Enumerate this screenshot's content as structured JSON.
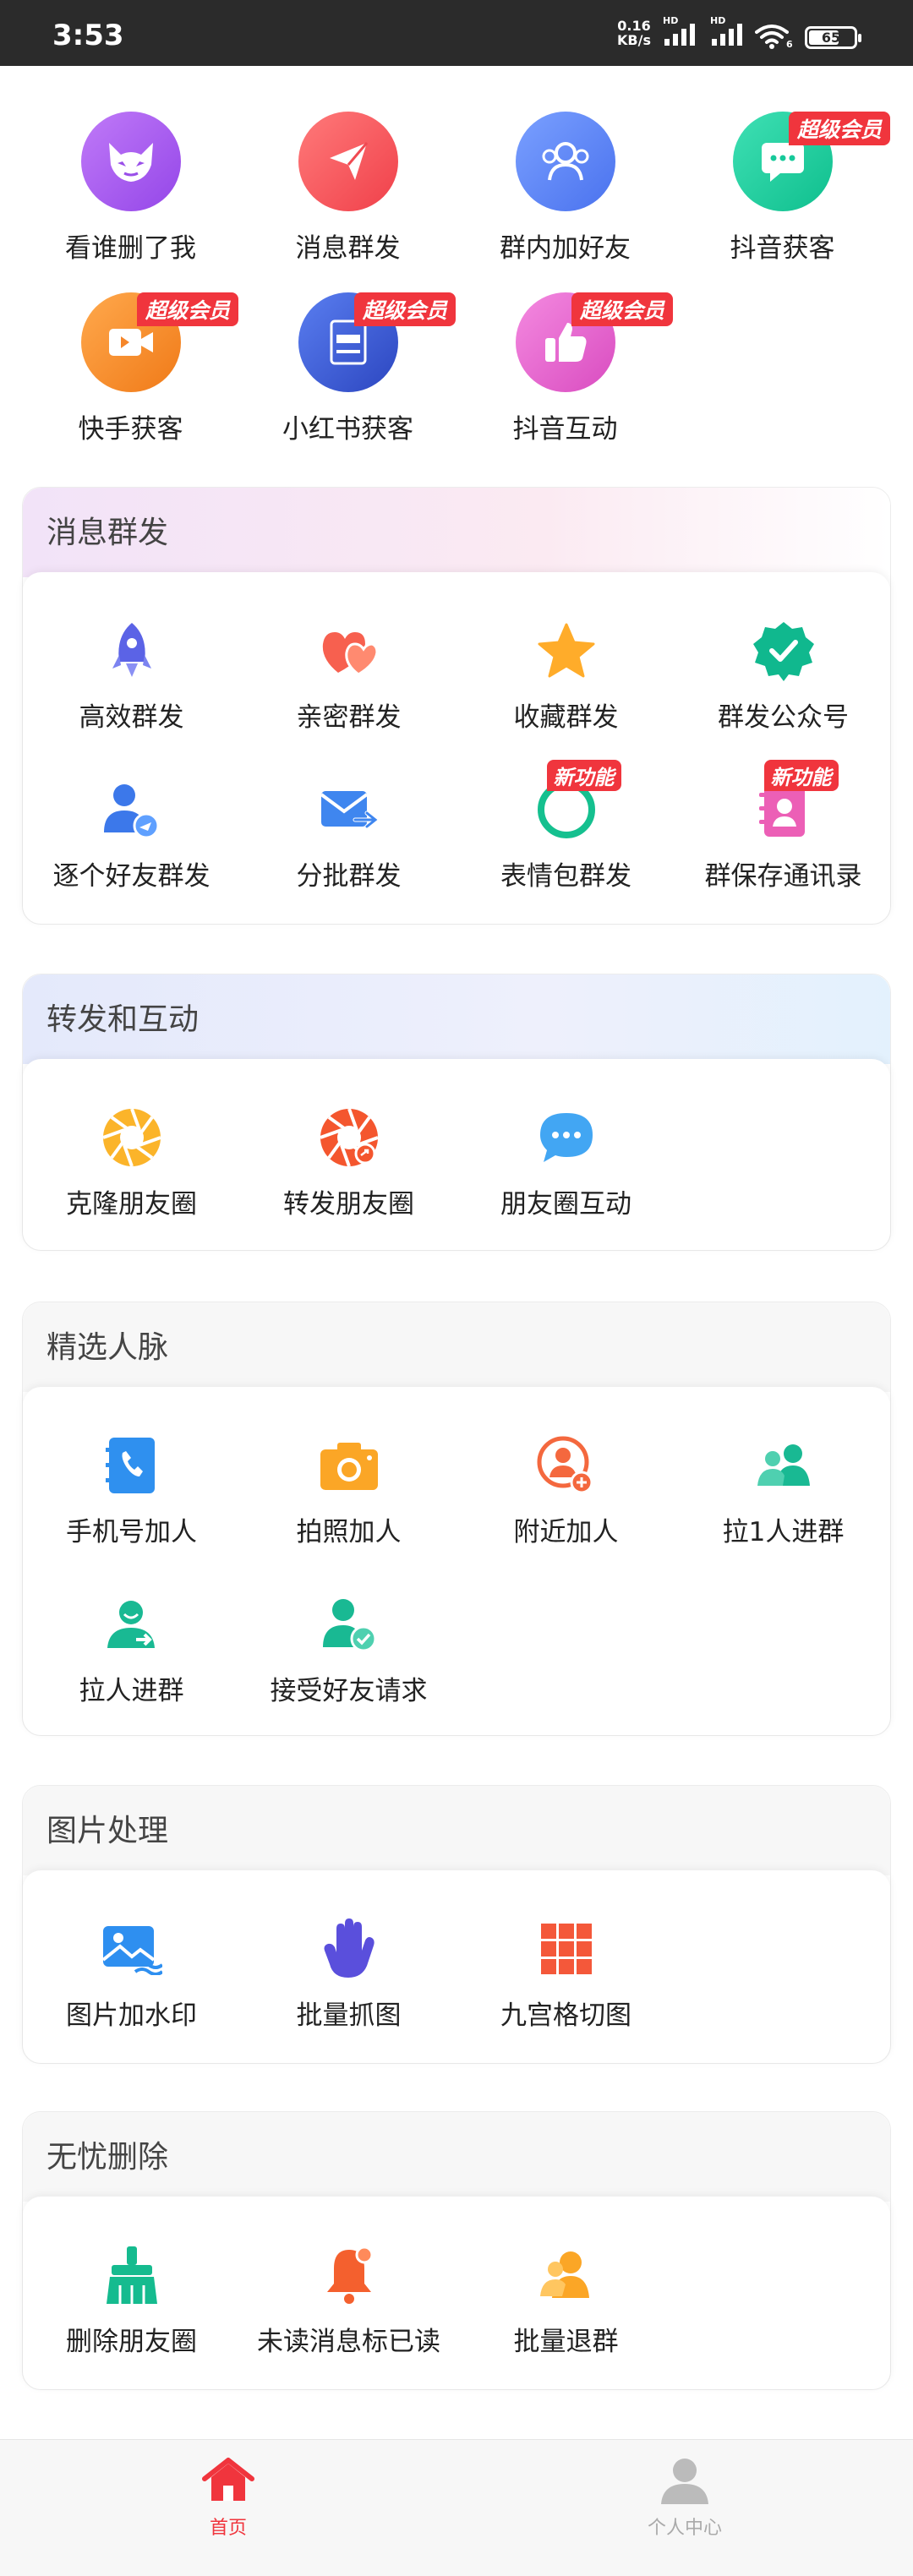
{
  "status_bar": {
    "time": "3:53",
    "net_speed_value": "0.16",
    "net_speed_unit": "KB/s",
    "signal_tag": "HD",
    "wifi_tag": "6",
    "battery": "65"
  },
  "quick_actions": [
    {
      "label": "看谁删了我",
      "icon": "devil-mask-icon",
      "color": "#a55cf0",
      "badge": ""
    },
    {
      "label": "消息群发",
      "icon": "paper-plane-icon",
      "color": "#f5555a",
      "badge": ""
    },
    {
      "label": "群内加好友",
      "icon": "group-icon",
      "color": "#5a83f5",
      "badge": ""
    },
    {
      "label": "抖音获客",
      "icon": "chat-bubble-icon",
      "color": "#17c99a",
      "badge": "超级会员"
    },
    {
      "label": "快手获客",
      "icon": "video-icon",
      "color": "#f7892a",
      "badge": "超级会员"
    },
    {
      "label": "小红书获客",
      "icon": "book-icon",
      "color": "#3f5fd6",
      "badge": "超级会员"
    },
    {
      "label": "抖音互动",
      "icon": "thumbs-up-icon",
      "color": "#e862c8",
      "badge": "超级会员"
    }
  ],
  "sections": {
    "mass_send": {
      "title": "消息群发",
      "items": [
        {
          "label": "高效群发",
          "icon": "rocket-icon",
          "badge": ""
        },
        {
          "label": "亲密群发",
          "icon": "hearts-icon",
          "badge": ""
        },
        {
          "label": "收藏群发",
          "icon": "star-icon",
          "badge": ""
        },
        {
          "label": "群发公众号",
          "icon": "verified-badge-icon",
          "badge": ""
        },
        {
          "label": "逐个好友群发",
          "icon": "user-send-icon",
          "badge": ""
        },
        {
          "label": "分批群发",
          "icon": "mail-send-icon",
          "badge": ""
        },
        {
          "label": "表情包群发",
          "icon": "emoji-icon",
          "badge": "新功能"
        },
        {
          "label": "群保存通讯录",
          "icon": "contacts-book-icon",
          "badge": "新功能"
        }
      ]
    },
    "forward": {
      "title": "转发和互动",
      "items": [
        {
          "label": "克隆朋友圈",
          "icon": "aperture-orange-icon",
          "badge": ""
        },
        {
          "label": "转发朋友圈",
          "icon": "aperture-red-icon",
          "badge": ""
        },
        {
          "label": "朋友圈互动",
          "icon": "comment-dots-icon",
          "badge": ""
        }
      ]
    },
    "contacts": {
      "title": "精选人脉",
      "items": [
        {
          "label": "手机号加人",
          "icon": "phone-book-icon",
          "badge": ""
        },
        {
          "label": "拍照加人",
          "icon": "camera-icon",
          "badge": ""
        },
        {
          "label": "附近加人",
          "icon": "nearby-user-icon",
          "badge": ""
        },
        {
          "label": "拉1人进群",
          "icon": "users-icon",
          "badge": ""
        },
        {
          "label": "拉人进群",
          "icon": "user-invite-icon",
          "badge": ""
        },
        {
          "label": "接受好友请求",
          "icon": "user-check-icon",
          "badge": ""
        }
      ]
    },
    "images": {
      "title": "图片处理",
      "items": [
        {
          "label": "图片加水印",
          "icon": "image-watermark-icon",
          "badge": ""
        },
        {
          "label": "批量抓图",
          "icon": "hand-grab-icon",
          "badge": ""
        },
        {
          "label": "九宫格切图",
          "icon": "grid-nine-icon",
          "badge": ""
        }
      ]
    },
    "cleanup": {
      "title": "无忧删除",
      "items": [
        {
          "label": "删除朋友圈",
          "icon": "broom-icon",
          "badge": ""
        },
        {
          "label": "未读消息标已读",
          "icon": "bell-icon",
          "badge": ""
        },
        {
          "label": "批量退群",
          "icon": "user-exit-icon",
          "badge": ""
        }
      ]
    }
  },
  "tab_bar": {
    "home": "首页",
    "profile": "个人中心",
    "active_color": "#f0353d",
    "inactive_color": "#bbbbbb"
  }
}
